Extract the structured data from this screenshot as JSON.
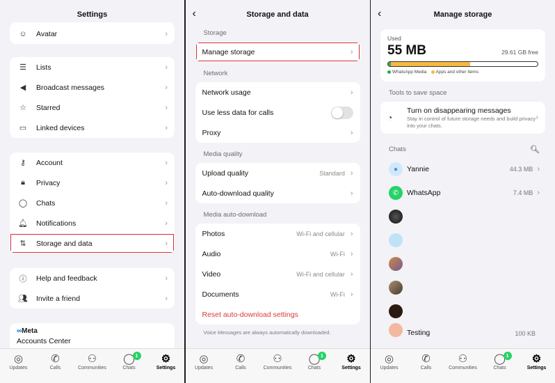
{
  "settings": {
    "title": "Settings",
    "top_item": "Avatar",
    "group1": [
      "Lists",
      "Broadcast messages",
      "Starred",
      "Linked devices"
    ],
    "group2": [
      "Account",
      "Privacy",
      "Chats",
      "Notifications",
      "Storage and data"
    ],
    "group3": [
      "Help and feedback",
      "Invite a friend"
    ],
    "meta": {
      "logo": "Meta",
      "accounts_center": "Accounts Center"
    }
  },
  "storage": {
    "title": "Storage and data",
    "storage_header": "Storage",
    "manage_storage": "Manage storage",
    "network_header": "Network",
    "network_usage": "Network usage",
    "use_less_data": "Use less data for calls",
    "proxy": "Proxy",
    "media_quality_header": "Media quality",
    "upload_quality": "Upload quality",
    "upload_quality_value": "Standard",
    "auto_download_quality": "Auto-download quality",
    "media_auto_header": "Media auto-download",
    "photos": "Photos",
    "photos_value": "Wi-Fi and cellular",
    "audio": "Audio",
    "audio_value": "Wi-Fi",
    "video": "Video",
    "video_value": "Wi-Fi and cellular",
    "documents": "Documents",
    "documents_value": "Wi-Fi",
    "reset": "Reset auto-download settings",
    "footnote": "Voice Messages are always automatically downloaded."
  },
  "manage": {
    "title": "Manage storage",
    "used_label": "Used",
    "used_value": "55 MB",
    "free": "29.61 GB free",
    "bar_whatsapp_fraction": 0.55,
    "bar_apps_fraction": 0.45,
    "legend_whatsapp": "WhatsApp Media",
    "legend_apps": "Apps and other items",
    "tools_header": "Tools to save space",
    "tip_title": "Turn on disappearing messages",
    "tip_sub": "Stay in control of future storage needs and build privacy into your chats.",
    "chats_header": "Chats",
    "chats": [
      {
        "name": "Yannie",
        "size": "44.3 MB"
      },
      {
        "name": "WhatsApp",
        "size": "7.4 MB"
      },
      {
        "name": "",
        "size": ""
      },
      {
        "name": "",
        "size": ""
      },
      {
        "name": "",
        "size": ""
      },
      {
        "name": "",
        "size": ""
      },
      {
        "name": "",
        "size": ""
      },
      {
        "name": "Testing",
        "size": "100 KB"
      }
    ]
  },
  "tabs": [
    "Updates",
    "Calls",
    "Communities",
    "Chats",
    "Settings"
  ],
  "chats_badge": "1",
  "colors": {
    "accent_green": "#25d366",
    "highlight_red": "#d62a3a",
    "bar_whatsapp": "#2eaa57",
    "bar_apps": "#f5b940"
  }
}
